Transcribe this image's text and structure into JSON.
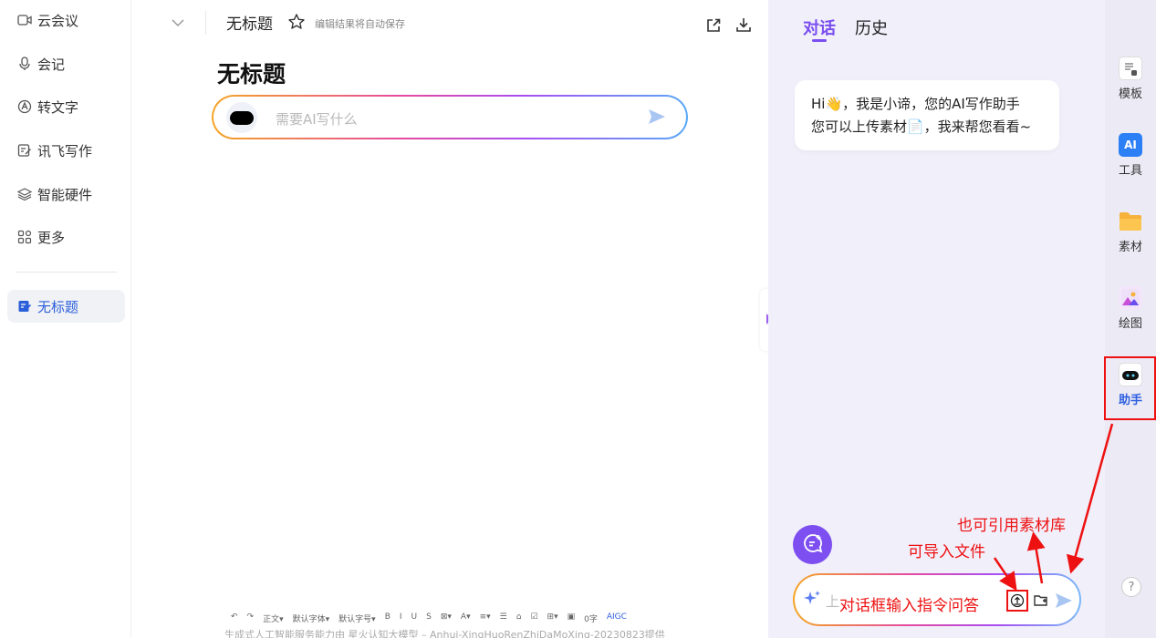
{
  "nav": {
    "items": [
      {
        "label": "云会议",
        "icon": "video-icon"
      },
      {
        "label": "会记",
        "icon": "microphone-icon"
      },
      {
        "label": "转文字",
        "icon": "text-convert-icon"
      },
      {
        "label": "讯飞写作",
        "icon": "edit-icon"
      },
      {
        "label": "智能硬件",
        "icon": "layers-icon"
      },
      {
        "label": "更多",
        "icon": "grid-icon"
      }
    ],
    "current_doc": "无标题"
  },
  "editor": {
    "title_small": "无标题",
    "autosave": "编辑结果将自动保存",
    "heading": "无标题",
    "ai_placeholder": "需要AI写什么",
    "format_bar": [
      "↶",
      "↷",
      "正文▾",
      "默认字体▾",
      "默认字号▾",
      "B",
      "I",
      "U",
      "S",
      "⊠▾",
      "A▾",
      "≡▾",
      "☰",
      "⌂",
      "☑",
      "⊞▾",
      "▣",
      "0字",
      "AIGC"
    ],
    "footer": "生成式人工智能服务能力由 星火认知大模型 – Anhui-XingHuoRenZhiDaMoXing-20230823提供"
  },
  "panel": {
    "tabs": [
      "对话",
      "历史"
    ],
    "greeting_line1": "Hi👋，我是小谛，您的AI写作助手",
    "greeting_line2": "您可以上传素材📄，我来帮您看看~",
    "input_placeholder": "上"
  },
  "rail": {
    "tools": [
      {
        "label": "模板",
        "icon": "template-icon"
      },
      {
        "label": "工具",
        "icon": "ai-tool-icon",
        "badge": "AI"
      },
      {
        "label": "素材",
        "icon": "folder-icon"
      },
      {
        "label": "绘图",
        "icon": "image-icon"
      },
      {
        "label": "助手",
        "icon": "assistant-icon"
      }
    ],
    "help": "?"
  },
  "annotations": {
    "library": "也可引用素材库",
    "import": "可导入文件",
    "input": "对话框输入指令问答"
  },
  "colors": {
    "accent": "#7a4ef0",
    "annotation": "#ee1111",
    "active_blue": "#2b5fd9"
  }
}
